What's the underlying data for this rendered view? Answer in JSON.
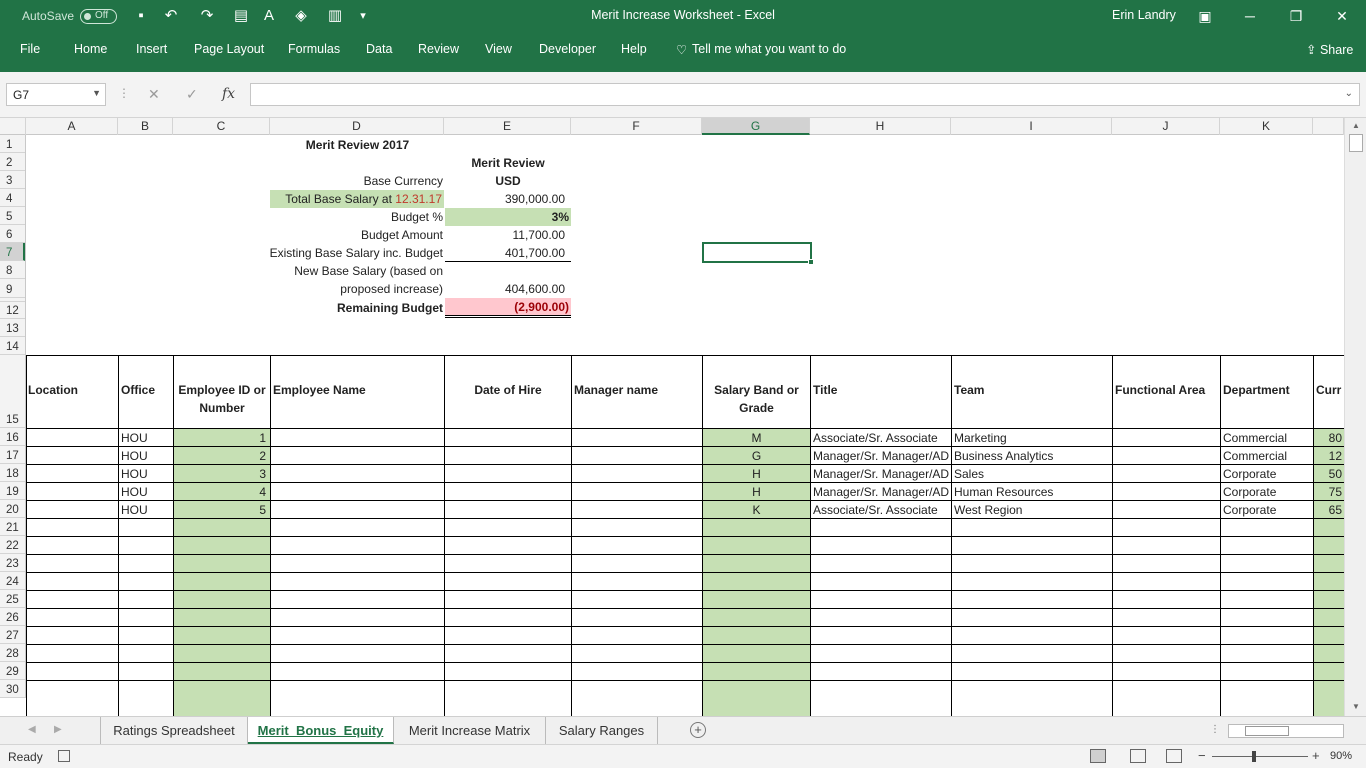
{
  "titlebar": {
    "autosave_label": "AutoSave",
    "autosave_state": "Off",
    "title": "Merit Increase Worksheet  -  Excel",
    "user": "Erin Landry"
  },
  "ribbon": {
    "tabs": [
      "File",
      "Home",
      "Insert",
      "Page Layout",
      "Formulas",
      "Data",
      "Review",
      "View",
      "Developer",
      "Help"
    ],
    "tell_me": "Tell me what you want to do",
    "share": "Share"
  },
  "formula_bar": {
    "name_box": "G7",
    "fx": "fx",
    "formula": ""
  },
  "columns": [
    "A",
    "B",
    "C",
    "D",
    "E",
    "F",
    "G",
    "H",
    "I",
    "J",
    "K",
    ""
  ],
  "rows": [
    "1",
    "2",
    "3",
    "4",
    "5",
    "6",
    "7",
    "8",
    "9",
    "",
    "12",
    "13",
    "14",
    "15",
    "16",
    "17",
    "18",
    "19",
    "20",
    "21",
    "22",
    "23",
    "24",
    "25",
    "26",
    "27",
    "28",
    "29",
    "30"
  ],
  "summary": {
    "title": "Merit Review 2017",
    "merit_review": "Merit Review",
    "base_currency_label": "Base Currency",
    "base_currency": "USD",
    "total_base_label": "Total Base Salary at ",
    "total_base_date": "12.31.17",
    "total_base": "390,000.00",
    "budget_pct_label": "Budget %",
    "budget_pct": "3%",
    "budget_amount_label": "Budget Amount",
    "budget_amount": "11,700.00",
    "existing_label": "Existing Base Salary inc. Budget",
    "existing": "401,700.00",
    "new_base_label_1": "New Base Salary (based on",
    "new_base_label_2": "proposed increase)",
    "new_base": "404,600.00",
    "remaining_label": "Remaining Budget",
    "remaining": "(2,900.00)"
  },
  "table": {
    "headers": {
      "location": "Location",
      "office": "Office",
      "emp_id_1": "Employee ID or",
      "emp_id_2": "Number",
      "emp_name": "Employee Name",
      "hire": "Date of Hire",
      "manager": "Manager name",
      "band_1": "Salary Band or",
      "band_2": "Grade",
      "title": "Title",
      "team": "Team",
      "functional": "Functional Area",
      "department": "Department",
      "current": "Curr"
    },
    "rows": [
      {
        "office": "HOU",
        "id": "1",
        "band": "M",
        "title": "Associate/Sr. Associate",
        "team": "Marketing",
        "dept": "Commercial",
        "curr": "80"
      },
      {
        "office": "HOU",
        "id": "2",
        "band": "G",
        "title": "Manager/Sr. Manager/AD",
        "team": "Business Analytics",
        "dept": "Commercial",
        "curr": "12"
      },
      {
        "office": "HOU",
        "id": "3",
        "band": "H",
        "title": "Manager/Sr. Manager/AD",
        "team": "Sales",
        "dept": "Corporate",
        "curr": "50"
      },
      {
        "office": "HOU",
        "id": "4",
        "band": "H",
        "title": "Manager/Sr. Manager/AD",
        "team": "Human Resources",
        "dept": "Corporate",
        "curr": "75"
      },
      {
        "office": "HOU",
        "id": "5",
        "band": "K",
        "title": "Associate/Sr. Associate",
        "team": "West Region",
        "dept": "Corporate",
        "curr": "65"
      }
    ]
  },
  "sheet_tabs": [
    "Ratings Spreadsheet",
    "Merit_Bonus_Equity",
    "Merit Increase Matrix",
    "Salary Ranges"
  ],
  "active_sheet": "Merit_Bonus_Equity",
  "status": {
    "ready": "Ready",
    "zoom": "90%",
    "zoom_minus": "−",
    "zoom_plus": "+"
  },
  "colors": {
    "accent": "#217346",
    "input_green": "#c6e0b4",
    "negative_pink": "#ffc7ce"
  }
}
